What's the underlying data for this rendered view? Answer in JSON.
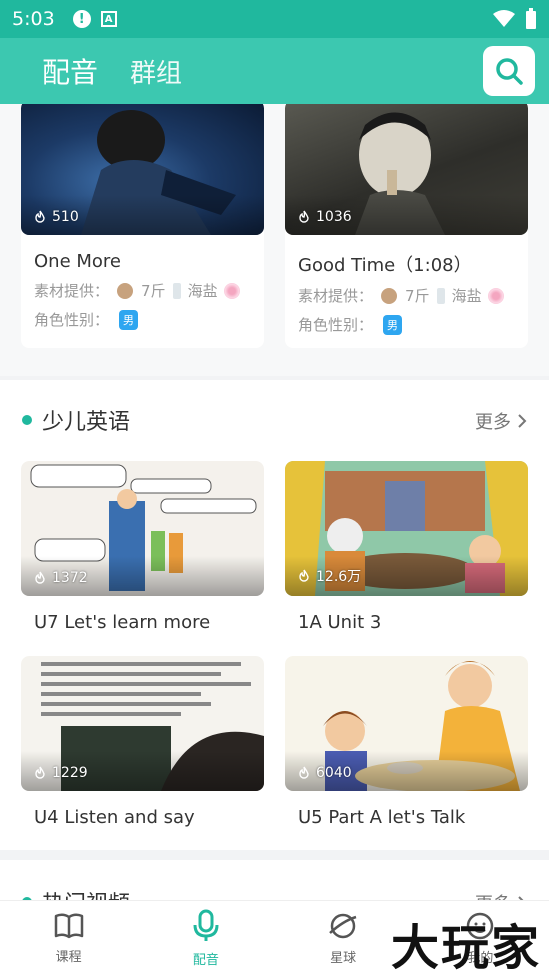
{
  "status_bar": {
    "time": "5:03"
  },
  "top_tabs": [
    {
      "label": "配音",
      "active": true
    },
    {
      "label": "群组",
      "active": false
    }
  ],
  "dub_cards": [
    {
      "views": "510",
      "title": "One More",
      "provider_label": "素材提供：",
      "provider_name": "7斤",
      "provider_extra": "海盐",
      "gender_label": "角色性别：",
      "gender": "男"
    },
    {
      "views": "1036",
      "title": "Good Time（1:08）",
      "provider_label": "素材提供：",
      "provider_name": "7斤",
      "provider_extra": "海盐",
      "gender_label": "角色性别：",
      "gender": "男"
    }
  ],
  "section_kids": {
    "title": "少儿英语",
    "more": "更多",
    "items": [
      {
        "views": "1372",
        "title": "U7 Let's learn more"
      },
      {
        "views": "12.6万",
        "title": "1A Unit 3"
      },
      {
        "views": "1229",
        "title": "U4 Listen and say"
      },
      {
        "views": "6040",
        "title": "U5 Part A let's Talk"
      }
    ]
  },
  "section_hot": {
    "title": "热门视频",
    "more": "更多"
  },
  "bottom_nav": [
    {
      "label": "课程",
      "icon": "book-icon",
      "active": false
    },
    {
      "label": "配音",
      "icon": "microphone-icon",
      "active": true
    },
    {
      "label": "星球",
      "icon": "planet-icon",
      "active": false
    },
    {
      "label": "我的",
      "icon": "profile-icon",
      "active": false
    }
  ],
  "watermark": "大玩家",
  "colors": {
    "accent": "#20b89e",
    "topbar": "#3cc8b0",
    "badge": "#2ea6f0"
  }
}
